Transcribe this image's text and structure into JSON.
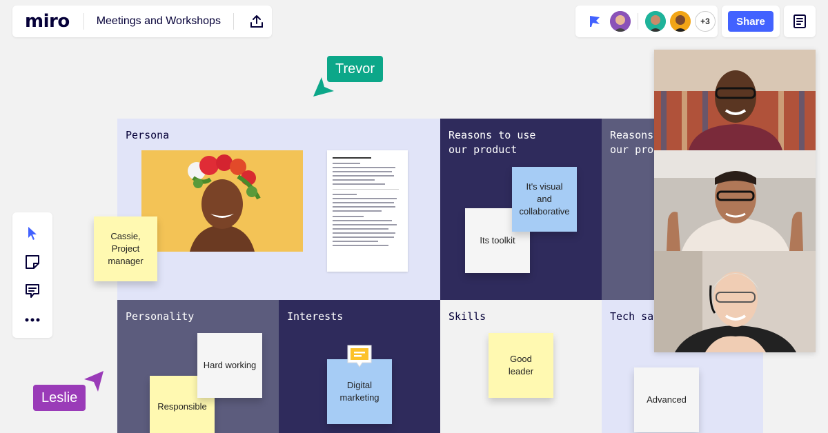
{
  "app": {
    "logo": "miro",
    "board_title": "Meetings and Workshops"
  },
  "header": {
    "collaborators_extra": "+3",
    "share_label": "Share"
  },
  "colors": {
    "accent": "#4262ff",
    "persona_bg": "#e1e4f8",
    "dark_navy": "#2f2b5c",
    "slate": "#5c5c7d",
    "trevor": "#0ca789",
    "leslie": "#9a3bb8",
    "sticky_yellow": "#fff9b1",
    "sticky_blue": "#a6ccf5",
    "sticky_white": "#f5f5f5"
  },
  "toolbar": {
    "tools": [
      "select-icon",
      "sticky-note-icon",
      "comment-icon",
      "more-icon"
    ]
  },
  "cursors": {
    "trevor": "Trevor",
    "leslie": "Leslie"
  },
  "board": {
    "persona": {
      "title": "Persona"
    },
    "reasons_1": {
      "title": "Reasons to use\nour product"
    },
    "reasons_2": {
      "title": "Reasons\nour prod"
    },
    "personality": {
      "title": "Personality"
    },
    "interests": {
      "title": "Interests"
    },
    "skills": {
      "title": "Skills"
    },
    "tech": {
      "title": "Tech sav"
    }
  },
  "stickies": {
    "cassie": "Cassie,\nProject\nmanager",
    "visual": "It's visual and\ncollaborative",
    "toolkit": "Its toolkit",
    "hard_working": "Hard working",
    "responsible": "Responsible",
    "digital": "Digital\nmarketing",
    "good_leader": "Good\nleader",
    "advanced": "Advanced"
  }
}
